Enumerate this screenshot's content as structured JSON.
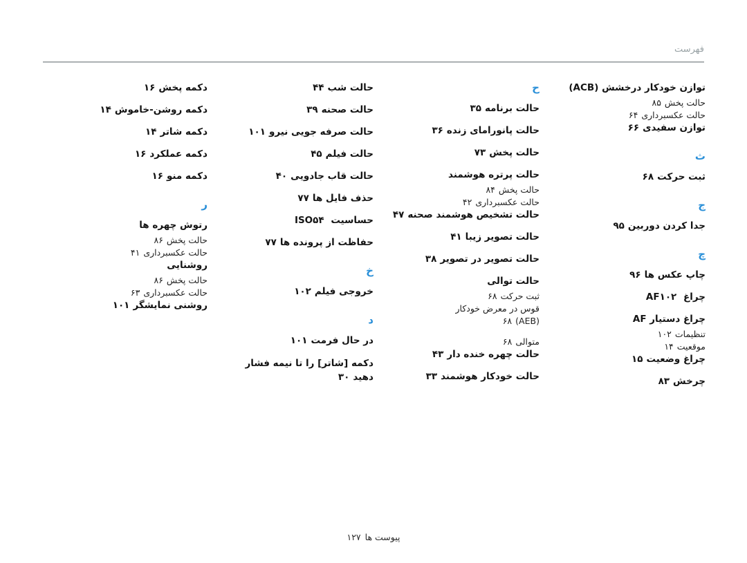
{
  "header": {
    "title": "فهرست"
  },
  "footer": {
    "label": "پیوست ها",
    "page": "۱۲۷"
  },
  "columns": [
    {
      "id": "column-1",
      "blocks": [
        {
          "kind": "entry",
          "label": "توازن خودکار درخشش (ACB)",
          "page": ""
        },
        {
          "kind": "sub",
          "label": "حالت پخش",
          "page": "۸۵"
        },
        {
          "kind": "sub",
          "label": "حالت عکسبرداری",
          "page": "۶۴"
        },
        {
          "kind": "entry",
          "label": "توازن سفیدی",
          "page": "۶۶"
        },
        {
          "kind": "letter",
          "label": "ث"
        },
        {
          "kind": "entry",
          "label": "ثبت حرکت",
          "page": "۶۸"
        },
        {
          "kind": "letter",
          "label": "ج"
        },
        {
          "kind": "entry",
          "label": "جدا کردن دوربین",
          "page": "۹۵"
        },
        {
          "kind": "letter",
          "label": "چ"
        },
        {
          "kind": "entry",
          "label": "چاپ عکس ها",
          "page": "۹۶"
        },
        {
          "kind": "entry",
          "label": "چراغ AF",
          "page": "۱۰۲"
        },
        {
          "kind": "entry",
          "label": "چراغ دستیار AF",
          "page": ""
        },
        {
          "kind": "sub",
          "label": "تنظیمات",
          "page": "۱۰۲"
        },
        {
          "kind": "sub",
          "label": "موقعیت",
          "page": "۱۴"
        },
        {
          "kind": "entry",
          "label": "چراغ وضعیت",
          "page": "۱۵"
        },
        {
          "kind": "entry",
          "label": "چرخش",
          "page": "۸۳"
        }
      ]
    },
    {
      "id": "column-2",
      "blocks": [
        {
          "kind": "letter",
          "label": "ح"
        },
        {
          "kind": "entry",
          "label": "حالت برنامه",
          "page": "۳۵"
        },
        {
          "kind": "entry",
          "label": "حالت پانورامای زنده",
          "page": "۳۶"
        },
        {
          "kind": "entry",
          "label": "حالت پخش",
          "page": "۷۳"
        },
        {
          "kind": "entry",
          "label": "حالت پرتره هوشمند",
          "page": ""
        },
        {
          "kind": "sub",
          "label": "حالت پخش",
          "page": "۸۴"
        },
        {
          "kind": "sub",
          "label": "حالت عکسبرداری",
          "page": "۴۲"
        },
        {
          "kind": "entry",
          "label": "حالت تشخیص هوشمند صحنه",
          "page": "۴۷"
        },
        {
          "kind": "entry",
          "label": "حالت تصویر زیبا",
          "page": "۴۱"
        },
        {
          "kind": "entry",
          "label": "حالت تصویر در تصویر",
          "page": "۳۸"
        },
        {
          "kind": "entry",
          "label": "حالت توالی",
          "page": ""
        },
        {
          "kind": "sub",
          "label": "ثبت حرکت",
          "page": "۶۸"
        },
        {
          "kind": "sub2",
          "label": "قوس در معرض خودکار",
          "label2": "(AEB)",
          "page": "۶۸"
        },
        {
          "kind": "sub",
          "label": "متوالی",
          "page": "۶۸"
        },
        {
          "kind": "entry",
          "label": "حالت چهره خنده دار",
          "page": "۴۳"
        },
        {
          "kind": "entry",
          "label": "حالت خودکار هوشمند",
          "page": "۳۳"
        }
      ]
    },
    {
      "id": "column-3",
      "blocks": [
        {
          "kind": "entry",
          "label": "حالت شب",
          "page": "۴۴"
        },
        {
          "kind": "entry",
          "label": "حالت صحنه",
          "page": "۳۹"
        },
        {
          "kind": "entry",
          "label": "حالت صرفه جویی نیرو",
          "page": "۱۰۱"
        },
        {
          "kind": "entry",
          "label": "حالت فیلم",
          "page": "۴۵"
        },
        {
          "kind": "entry",
          "label": "حالت قاب جادویی",
          "page": "۴۰"
        },
        {
          "kind": "entry",
          "label": "حذف فایل ها",
          "page": "۷۷"
        },
        {
          "kind": "entry",
          "label": "حساسیت ISO",
          "page": "۵۴"
        },
        {
          "kind": "entry",
          "label": "حفاظت از پرونده ها",
          "page": "۷۷"
        },
        {
          "kind": "letter",
          "label": "خ"
        },
        {
          "kind": "entry",
          "label": "خروجی فیلم",
          "page": "۱۰۲"
        },
        {
          "kind": "letter",
          "label": "د"
        },
        {
          "kind": "entry",
          "label": "در حال فرمت",
          "page": "۱۰۱"
        },
        {
          "kind": "entry2",
          "label": "دکمه [شاتر] را تا نیمه فشار",
          "label2": "دهید",
          "page": "۳۰"
        }
      ]
    },
    {
      "id": "column-4",
      "blocks": [
        {
          "kind": "entry",
          "label": "دکمه پخش",
          "page": "۱۶"
        },
        {
          "kind": "entry",
          "label": "دکمه روشن-خاموش",
          "page": "۱۴"
        },
        {
          "kind": "entry",
          "label": "دکمه شاتر",
          "page": "۱۴"
        },
        {
          "kind": "entry",
          "label": "دکمه عملکرد",
          "page": "۱۶"
        },
        {
          "kind": "entry",
          "label": "دکمه منو",
          "page": "۱۶"
        },
        {
          "kind": "letter",
          "label": "ر"
        },
        {
          "kind": "entry",
          "label": "رتوش چهره ها",
          "page": ""
        },
        {
          "kind": "sub",
          "label": "حالت پخش",
          "page": "۸۶"
        },
        {
          "kind": "sub",
          "label": "حالت عکسبرداری",
          "page": "۴۱"
        },
        {
          "kind": "entry",
          "label": "روشنایی",
          "page": ""
        },
        {
          "kind": "sub",
          "label": "حالت پخش",
          "page": "۸۶"
        },
        {
          "kind": "sub",
          "label": "حالت عکسبرداری",
          "page": "۶۳"
        },
        {
          "kind": "entry",
          "label": "روشنی نمایشگر",
          "page": "۱۰۱"
        }
      ]
    }
  ]
}
